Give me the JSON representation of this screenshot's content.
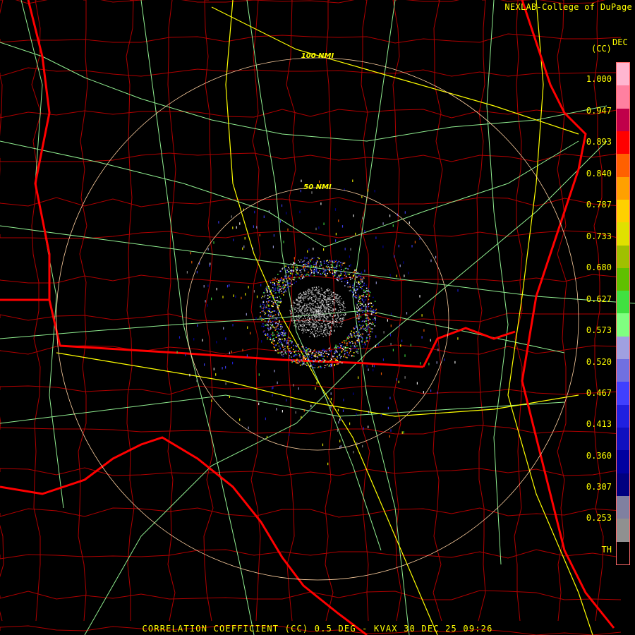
{
  "credit": "NEXLAB-College of DuPage",
  "product_abbrev": "(CC)",
  "product_unit": "DEC",
  "footer_title": "CORRELATION COEFFICIENT (CC) 0.5 DEG - KVAX 30 DEC 25 09:26",
  "range_rings": [
    {
      "label": "50 NMI"
    },
    {
      "label": "100 NMI"
    }
  ],
  "legend": {
    "ticks": [
      "1.000",
      "0.947",
      "0.893",
      "0.840",
      "0.787",
      "0.733",
      "0.680",
      "0.627",
      "0.573",
      "0.520",
      "0.467",
      "0.413",
      "0.360",
      "0.307",
      "0.253",
      "TH"
    ],
    "colors": [
      "#ffb6d0",
      "#ff80a0",
      "#c0004a",
      "#ff0000",
      "#ff6000",
      "#ffa000",
      "#ffd000",
      "#e0e000",
      "#a0c000",
      "#60c000",
      "#40e040",
      "#80ff80",
      "#a0a0e0",
      "#7070e0",
      "#4040ff",
      "#2020e0",
      "#1010c0",
      "#0000a0",
      "#000080",
      "#8080a0",
      "#909090",
      "#000000"
    ]
  },
  "colors": {
    "state_border": "#ff0000",
    "county_border": "#b00000",
    "highway": "#ffff00",
    "road": "#90ee90",
    "range_ring": "#ffd0a0",
    "text": "#ffff00"
  }
}
